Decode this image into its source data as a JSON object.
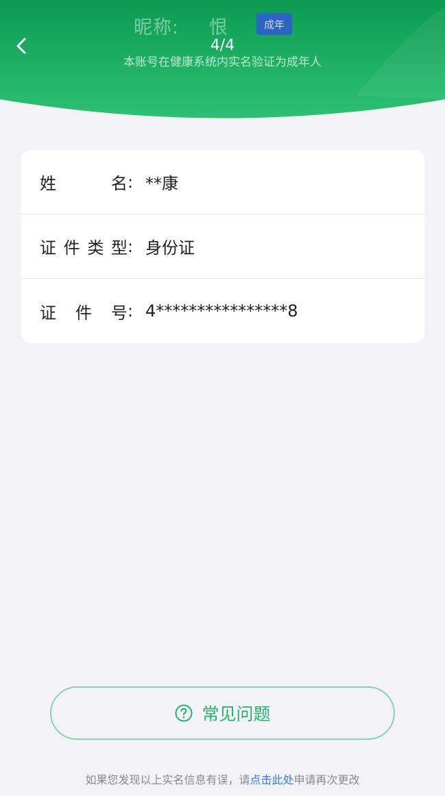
{
  "header": {
    "nickname_label": "昵称:",
    "nickname_value": "恨",
    "badge": "成年",
    "page_counter": "4/4",
    "subtitle": "本账号在健康系统内实名验证为成年人"
  },
  "colors": {
    "green_dark": "#0fa45a",
    "green_light": "#3fc57e",
    "badge_blue": "#2e63c6",
    "link_blue": "#2d7de8",
    "faq_green": "#24b36b"
  },
  "info": {
    "name_label_1": "姓",
    "name_label_2": "名",
    "name_value": "**康",
    "type_label": [
      "证",
      "件",
      "类",
      "型"
    ],
    "type_value": "身份证",
    "id_label": [
      "证",
      "件",
      "号"
    ],
    "id_value": "4****************8",
    "colon": ":"
  },
  "faq": {
    "icon": "question-circle-icon",
    "label": "常见问题"
  },
  "footer": {
    "text_before": "如果您发现以上实名信息有误，请",
    "link_text": "点击此处",
    "text_after": "申请再次更改"
  }
}
